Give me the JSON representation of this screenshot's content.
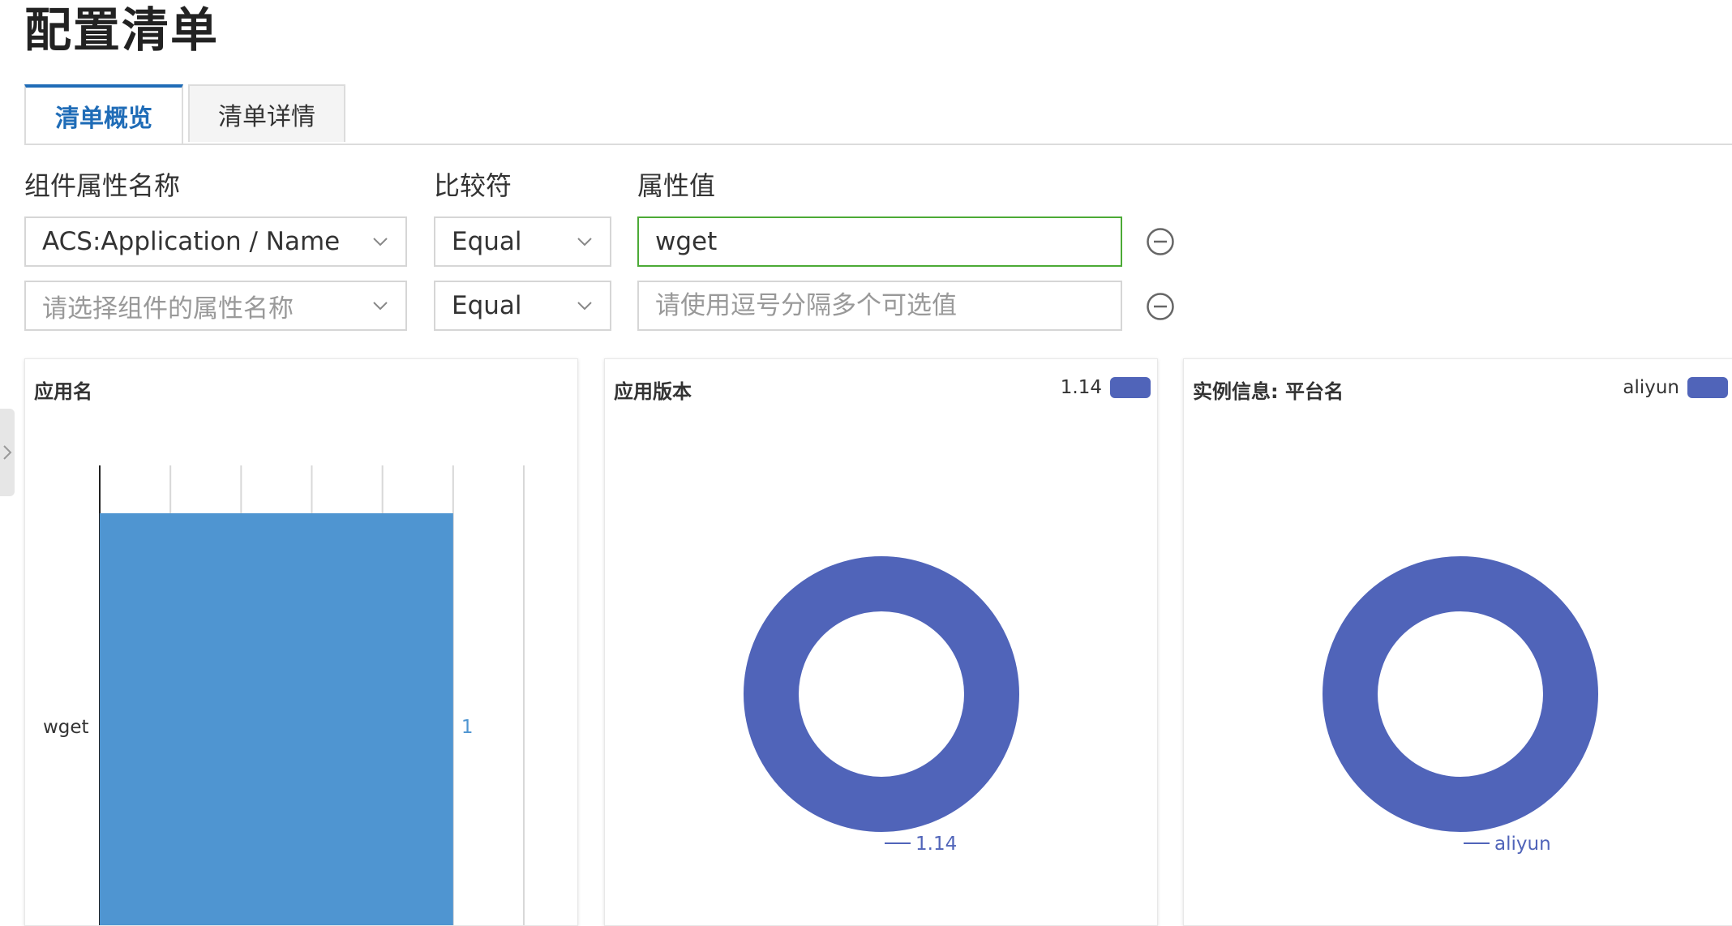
{
  "page": {
    "title": "配置清单"
  },
  "tabs": [
    {
      "label": "清单概览",
      "active": true
    },
    {
      "label": "清单详情",
      "active": false
    }
  ],
  "filter": {
    "labels": {
      "property": "组件属性名称",
      "comparator": "比较符",
      "value": "属性值"
    },
    "rows": [
      {
        "property": "ACS:Application / Name",
        "comparator": "Equal",
        "value": "wget",
        "value_placeholder": ""
      },
      {
        "property_placeholder": "请选择组件的属性名称",
        "comparator": "Equal",
        "value": "",
        "value_placeholder": "请使用逗号分隔多个可选值"
      }
    ]
  },
  "cards": [
    {
      "title": "应用名"
    },
    {
      "title": "应用版本",
      "legend": "1.14",
      "bottom_label": "1.14"
    },
    {
      "title": "实例信息: 平台名",
      "legend": "aliyun",
      "bottom_label": "aliyun"
    }
  ],
  "colors": {
    "accent": "#1f6cb7",
    "bar": "#4f95d1",
    "donut": "#5064b9",
    "active_border": "#4caa36"
  },
  "chart_data": [
    {
      "type": "bar",
      "orientation": "horizontal",
      "title": "应用名",
      "categories": [
        "wget"
      ],
      "values": [
        1
      ],
      "data_labels": [
        "1"
      ],
      "xlim": [
        0,
        1.2
      ],
      "grid": true,
      "color": "#4f95d1"
    },
    {
      "type": "pie",
      "donut": true,
      "title": "应用版本",
      "labels": [
        "1.14"
      ],
      "values": [
        1
      ],
      "legend_position": "top-right",
      "color": "#5064b9"
    },
    {
      "type": "pie",
      "donut": true,
      "title": "实例信息: 平台名",
      "labels": [
        "aliyun"
      ],
      "values": [
        1
      ],
      "legend_position": "top-right",
      "color": "#5064b9"
    }
  ]
}
